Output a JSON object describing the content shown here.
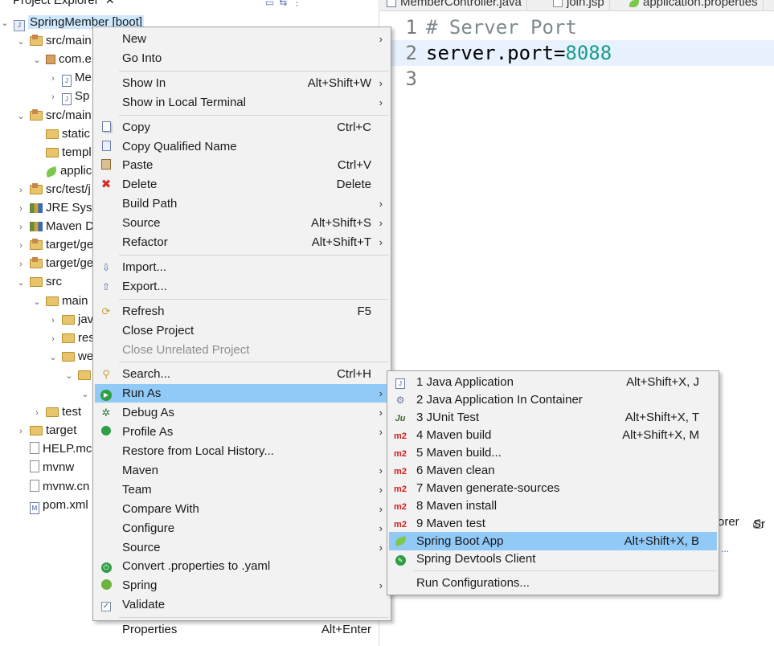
{
  "explorer": {
    "tab_label": "Project Explorer",
    "close_glyph": "✕",
    "tree": [
      {
        "label": "SpringMember [boot]",
        "indent": 0,
        "icon": "project-icon",
        "expanded": true,
        "selected": true
      },
      {
        "label": "src/main",
        "indent": 1,
        "icon": "source-folder-icon",
        "expanded": true
      },
      {
        "label": "com.e",
        "indent": 2,
        "icon": "package-icon",
        "expanded": true
      },
      {
        "label": "Me",
        "indent": 3,
        "icon": "java-file-icon",
        "expanded": false
      },
      {
        "label": "Sp",
        "indent": 3,
        "icon": "java-file-icon",
        "expanded": false
      },
      {
        "label": "src/main",
        "indent": 1,
        "icon": "source-folder-icon",
        "expanded": true
      },
      {
        "label": "static",
        "indent": 2,
        "icon": "folder-icon",
        "leaf": true
      },
      {
        "label": "templ",
        "indent": 2,
        "icon": "folder-icon",
        "leaf": true
      },
      {
        "label": "applic",
        "indent": 2,
        "icon": "spring-leaf-icon",
        "leaf": true
      },
      {
        "label": "src/test/j",
        "indent": 1,
        "icon": "source-folder-icon",
        "expanded": false
      },
      {
        "label": "JRE Syste",
        "indent": 1,
        "icon": "library-icon",
        "expanded": false
      },
      {
        "label": "Maven D",
        "indent": 1,
        "icon": "library-icon",
        "expanded": false
      },
      {
        "label": "target/ge",
        "indent": 1,
        "icon": "source-folder-icon",
        "expanded": false
      },
      {
        "label": "target/ge",
        "indent": 1,
        "icon": "source-folder-icon",
        "expanded": false
      },
      {
        "label": "src",
        "indent": 1,
        "icon": "folder-icon",
        "expanded": true
      },
      {
        "label": "main",
        "indent": 2,
        "icon": "folder-icon",
        "expanded": true
      },
      {
        "label": "jav",
        "indent": 3,
        "icon": "folder-icon",
        "expanded": false
      },
      {
        "label": "res",
        "indent": 3,
        "icon": "folder-icon",
        "expanded": false
      },
      {
        "label": "we",
        "indent": 3,
        "icon": "folder-icon",
        "expanded": true
      },
      {
        "label": "",
        "indent": 4,
        "icon": "folder-icon",
        "expanded": true
      },
      {
        "label": "",
        "indent": 5,
        "icon": "",
        "expanded": true
      },
      {
        "label": "test",
        "indent": 2,
        "icon": "folder-icon",
        "expanded": false
      },
      {
        "label": "target",
        "indent": 1,
        "icon": "folder-icon",
        "expanded": false
      },
      {
        "label": "HELP.mc",
        "indent": 1,
        "icon": "file-icon",
        "leaf": true
      },
      {
        "label": "mvnw",
        "indent": 1,
        "icon": "file-icon",
        "leaf": true
      },
      {
        "label": "mvnw.cn",
        "indent": 1,
        "icon": "file-icon",
        "leaf": true
      },
      {
        "label": "pom.xml",
        "indent": 1,
        "icon": "maven-file-icon",
        "leaf": true
      }
    ]
  },
  "editor": {
    "tabs": [
      {
        "label": "MemberController.java",
        "icon": "java-file-icon"
      },
      {
        "label": "join.jsp",
        "icon": "jsp-file-icon"
      },
      {
        "label": "application.properties",
        "icon": "spring-leaf-icon"
      }
    ],
    "lines": [
      {
        "number": "1",
        "comment": "# Server Port"
      },
      {
        "number": "2",
        "key": "server.port=",
        "value": "8088"
      },
      {
        "number": "3",
        "text": ""
      }
    ],
    "bottom_tabs": [
      "orer",
      "Sr"
    ],
    "bottom_link": "..."
  },
  "context_menu": {
    "items": [
      {
        "label": "New",
        "submenu": true
      },
      {
        "label": "Go Into"
      },
      {
        "sep": true
      },
      {
        "label": "Show In",
        "accel": "Alt+Shift+W",
        "submenu": true
      },
      {
        "label": "Show in Local Terminal",
        "submenu": true
      },
      {
        "sep": true
      },
      {
        "label": "Copy",
        "accel": "Ctrl+C",
        "icon": "copy-icon"
      },
      {
        "label": "Copy Qualified Name",
        "icon": "copy-qualified-name-icon"
      },
      {
        "label": "Paste",
        "accel": "Ctrl+V",
        "icon": "paste-icon"
      },
      {
        "label": "Delete",
        "accel": "Delete",
        "icon": "delete-icon"
      },
      {
        "label": "Build Path",
        "submenu": true
      },
      {
        "label": "Source",
        "accel": "Alt+Shift+S",
        "submenu": true
      },
      {
        "label": "Refactor",
        "accel": "Alt+Shift+T",
        "submenu": true
      },
      {
        "sep": true
      },
      {
        "label": "Import...",
        "icon": "import-icon"
      },
      {
        "label": "Export...",
        "icon": "export-icon"
      },
      {
        "sep": true
      },
      {
        "label": "Refresh",
        "accel": "F5",
        "icon": "refresh-icon"
      },
      {
        "label": "Close Project"
      },
      {
        "label": "Close Unrelated Project",
        "disabled": true
      },
      {
        "sep": true
      },
      {
        "label": "Search...",
        "accel": "Ctrl+H",
        "icon": "search-icon"
      },
      {
        "label": "Run As",
        "submenu": true,
        "icon": "run-icon",
        "highlighted": true
      },
      {
        "label": "Debug As",
        "submenu": true,
        "icon": "debug-icon"
      },
      {
        "label": "Profile As",
        "submenu": true,
        "icon": "profile-icon"
      },
      {
        "label": "Restore from Local History..."
      },
      {
        "label": "Maven",
        "submenu": true
      },
      {
        "label": "Team",
        "submenu": true
      },
      {
        "label": "Compare With",
        "submenu": true
      },
      {
        "label": "Configure",
        "submenu": true
      },
      {
        "label": "Source",
        "submenu": true
      },
      {
        "label": "Convert .properties to .yaml",
        "icon": "spring-power-icon"
      },
      {
        "label": "Spring",
        "submenu": true,
        "icon": "spring-icon"
      },
      {
        "label": "Validate",
        "icon": "validate-checkbox-icon"
      },
      {
        "sep": true
      },
      {
        "label": "Properties",
        "accel": "Alt+Enter"
      }
    ]
  },
  "run_as_menu": {
    "items": [
      {
        "label": "1 Java Application",
        "accel": "Alt+Shift+X, J",
        "icon": "java-application-icon"
      },
      {
        "label": "2 Java Application In Container",
        "icon": "java-container-icon"
      },
      {
        "label": "3 JUnit Test",
        "accel": "Alt+Shift+X, T",
        "icon": "junit-icon"
      },
      {
        "label": "4 Maven build",
        "accel": "Alt+Shift+X, M",
        "icon": "maven-icon"
      },
      {
        "label": "5 Maven build...",
        "icon": "maven-icon"
      },
      {
        "label": "6 Maven clean",
        "icon": "maven-icon"
      },
      {
        "label": "7 Maven generate-sources",
        "icon": "maven-icon"
      },
      {
        "label": "8 Maven install",
        "icon": "maven-icon"
      },
      {
        "label": "9 Maven test",
        "icon": "maven-icon"
      },
      {
        "label": "Spring Boot App",
        "accel": "Alt+Shift+X, B",
        "icon": "spring-boot-icon",
        "highlighted": true
      },
      {
        "label": "Spring Devtools Client",
        "icon": "spring-devtools-icon"
      },
      {
        "sep": true
      },
      {
        "label": "Run Configurations..."
      }
    ]
  }
}
